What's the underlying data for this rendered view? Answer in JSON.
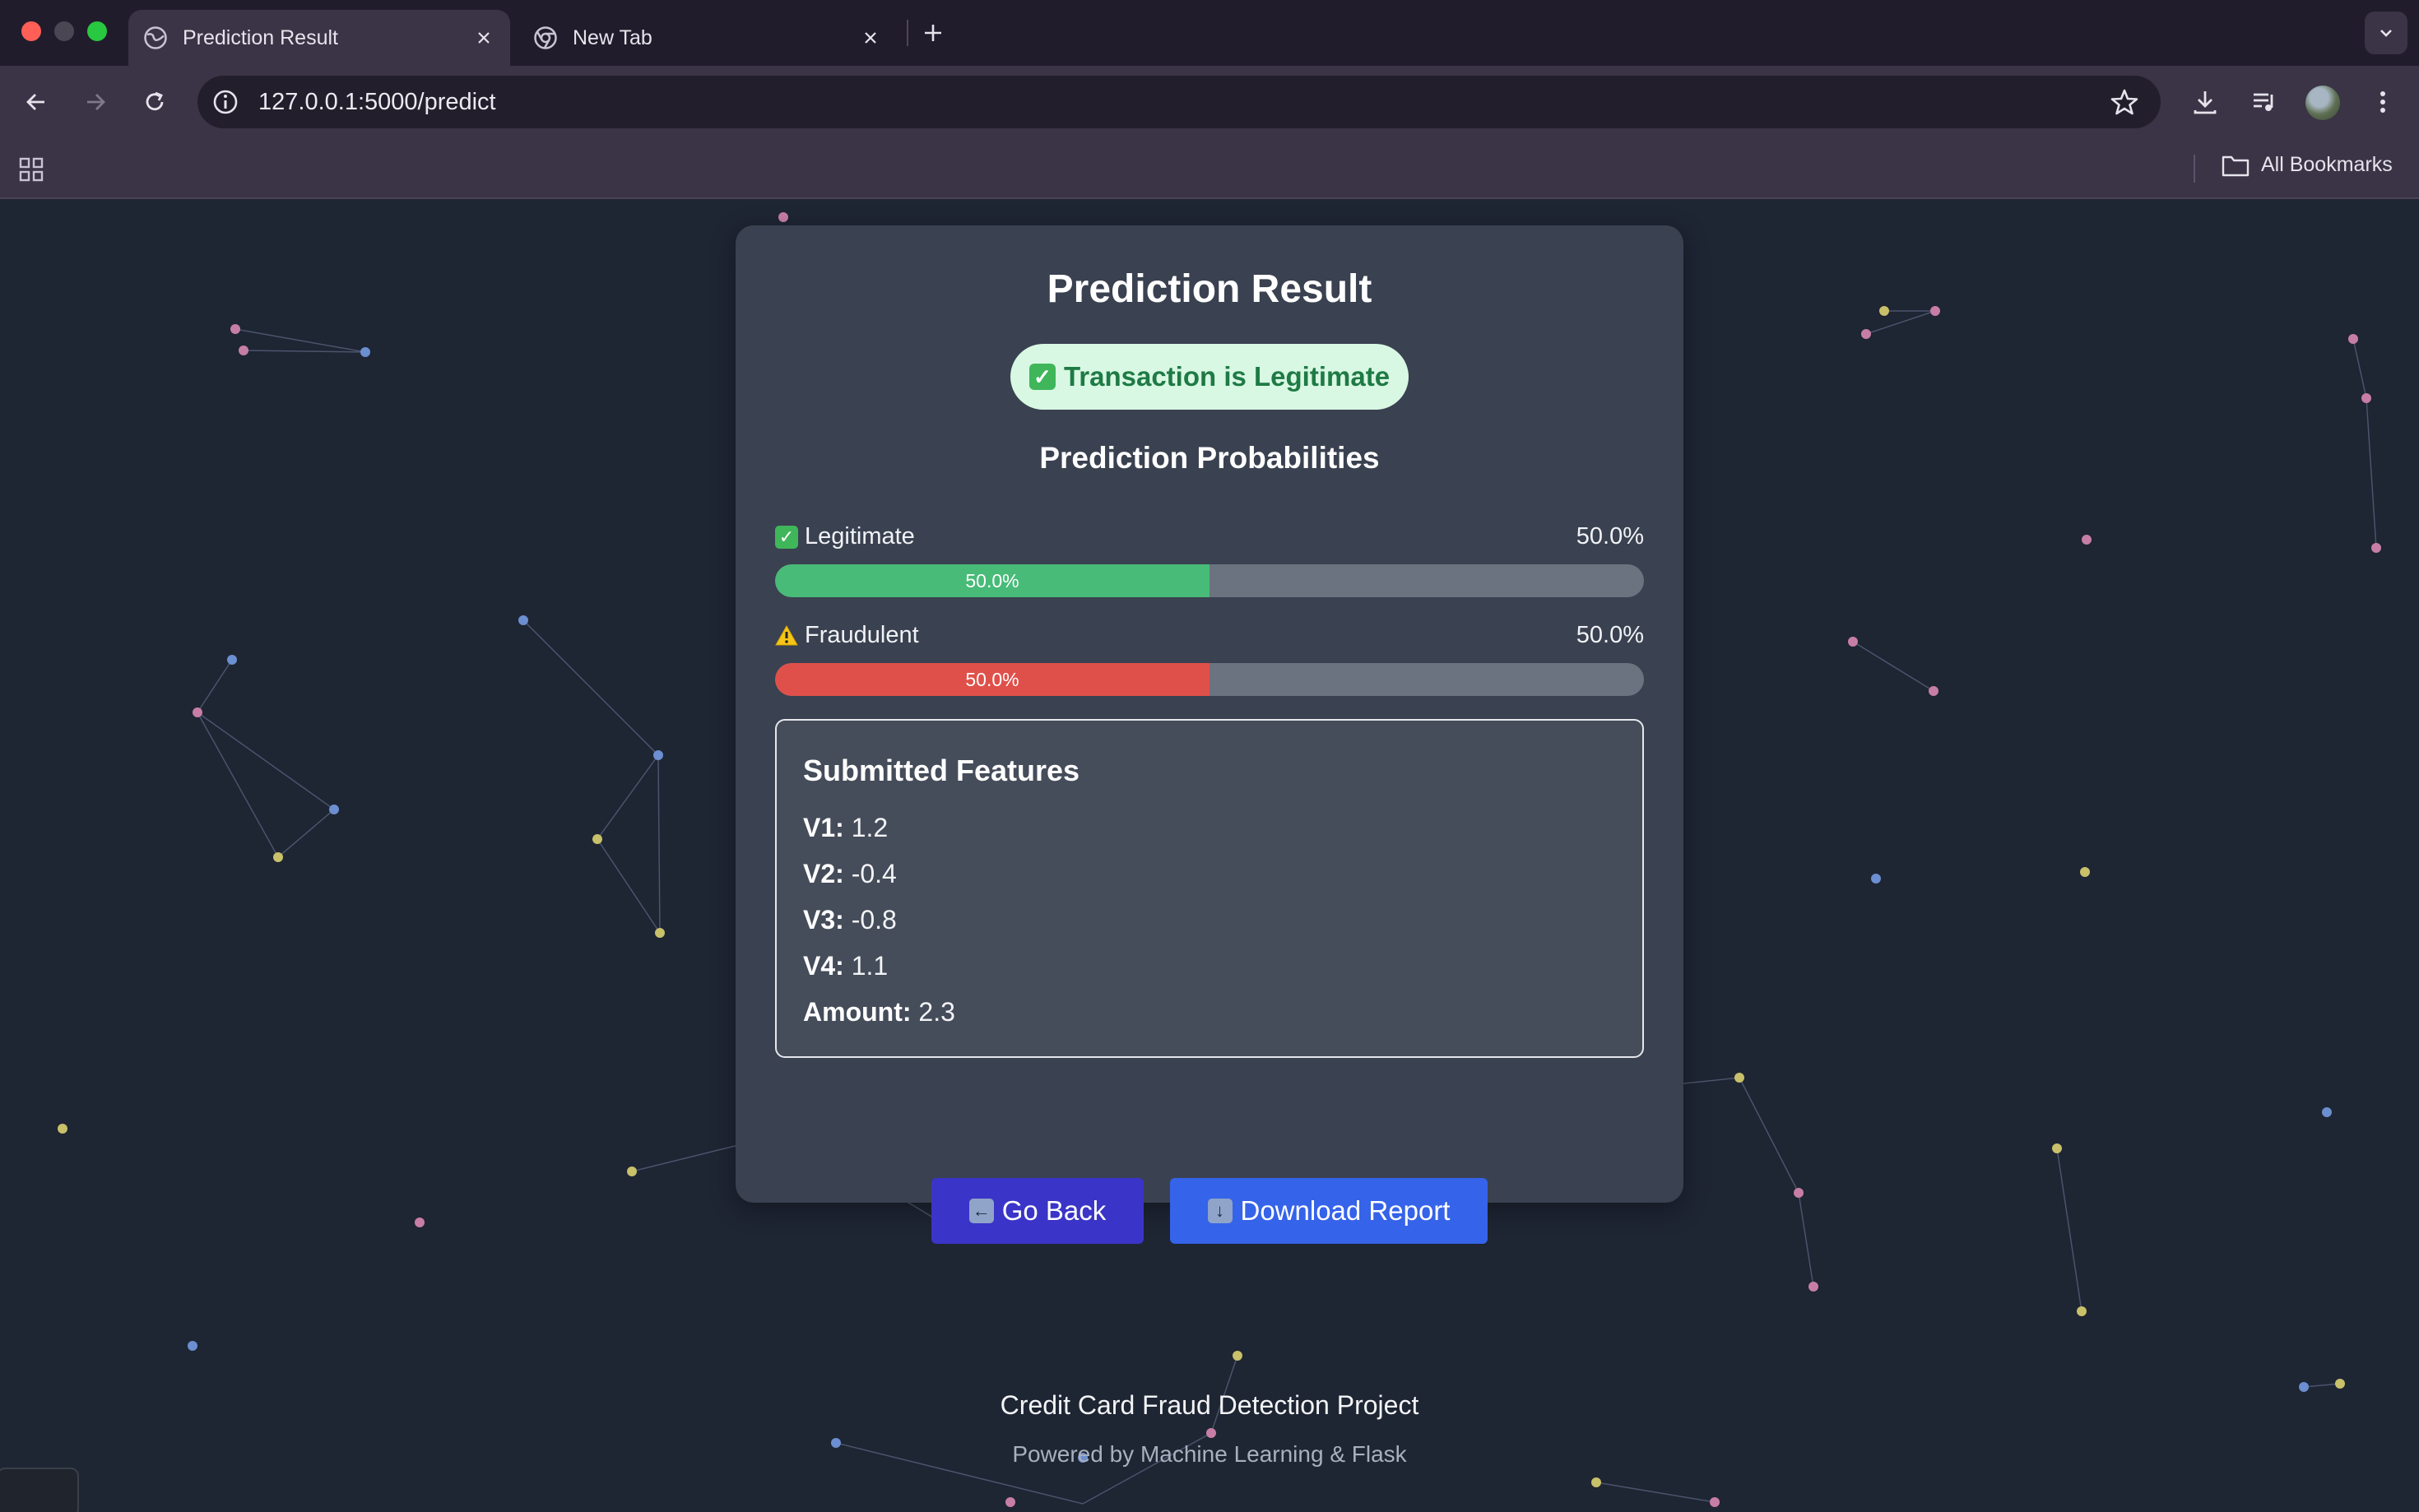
{
  "browser": {
    "tabs": [
      {
        "title": "Prediction Result",
        "active": true,
        "icon": "globe-icon"
      },
      {
        "title": "New Tab",
        "active": false,
        "icon": "chrome-icon"
      }
    ],
    "url": "127.0.0.1:5000/predict",
    "bookmarks_label": "All Bookmarks"
  },
  "result": {
    "title": "Prediction Result",
    "status_icon": "✅",
    "status_text": "Transaction is Legitimate",
    "probabilities_title": "Prediction Probabilities",
    "probabilities": [
      {
        "icon": "✅",
        "label": "Legitimate",
        "percent_text": "50.0%",
        "bar_text": "50.0%",
        "value": 0.5,
        "color": "#48bb78"
      },
      {
        "icon": "⚠️",
        "label": "Fraudulent",
        "percent_text": "50.0%",
        "bar_text": "50.0%",
        "value": 0.5,
        "color": "#e0504a"
      }
    ]
  },
  "features": {
    "title": "Submitted Features",
    "items": [
      {
        "name": "V1:",
        "value": "1.2"
      },
      {
        "name": "V2:",
        "value": "-0.4"
      },
      {
        "name": "V3:",
        "value": "-0.8"
      },
      {
        "name": "V4:",
        "value": "1.1"
      },
      {
        "name": "Amount:",
        "value": "2.3"
      }
    ]
  },
  "actions": {
    "back_icon": "⬅️",
    "back_label": "Go Back",
    "download_icon": "⬇️",
    "download_label": "Download Report"
  },
  "footer": {
    "title": "Credit Card Fraud Detection Project",
    "subtitle": "Powered by Machine Learning & Flask"
  },
  "colors": {
    "page_bg": "#1e2533",
    "card_bg": "#3a4150",
    "legit": "#48bb78",
    "fraud": "#e0504a",
    "back_button": "#3b34c8",
    "download_button": "#3563e9"
  }
}
